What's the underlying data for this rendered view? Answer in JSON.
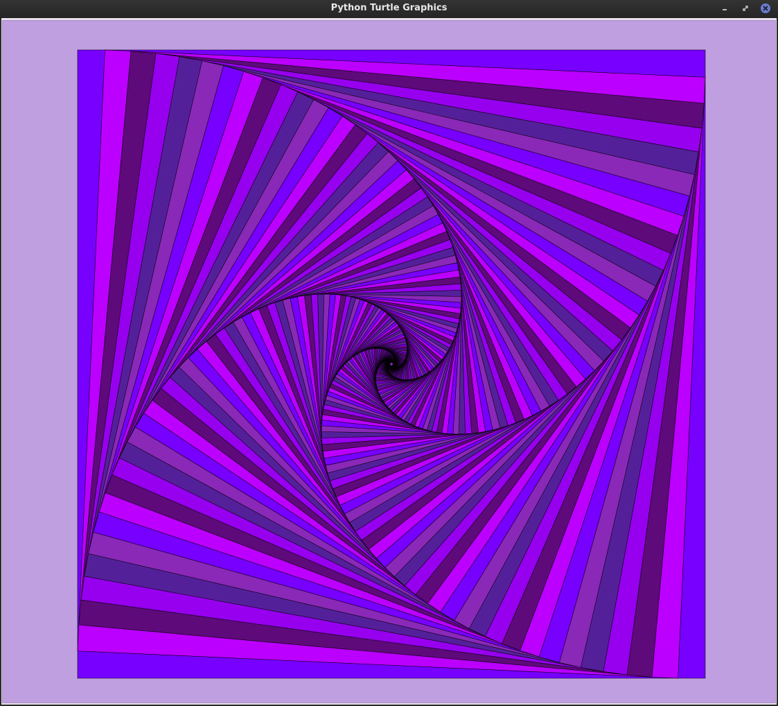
{
  "window": {
    "title": "Python Turtle Graphics"
  },
  "controls": {
    "minimize_icon": "minimize-icon",
    "maximize_icon": "maximize-icon",
    "close_icon": "close-icon"
  },
  "canvas": {
    "background_color": "#bf9fdf",
    "square_color": "#7700ff",
    "stroke_color": "#000000",
    "palette": [
      "#bb00ff",
      "#5e0a7a",
      "#9600ee",
      "#54209a",
      "#8a28b8",
      "#7700ff"
    ]
  }
}
